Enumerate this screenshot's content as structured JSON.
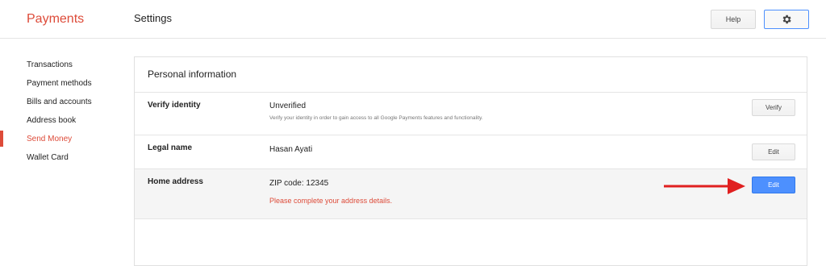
{
  "header": {
    "brand": "Payments",
    "page_title": "Settings",
    "help_label": "Help",
    "settings_icon": "gear-icon"
  },
  "sidebar": {
    "items": [
      {
        "label": "Transactions"
      },
      {
        "label": "Payment methods"
      },
      {
        "label": "Bills and accounts"
      },
      {
        "label": "Address book"
      },
      {
        "label": "Send Money",
        "active": true
      },
      {
        "label": "Wallet Card"
      }
    ]
  },
  "panel": {
    "title": "Personal information",
    "rows": {
      "verify": {
        "label": "Verify identity",
        "value": "Unverified",
        "description": "Verify your identity in order to gain access to all Google Payments features and functionality.",
        "button": "Verify"
      },
      "legal": {
        "label": "Legal name",
        "value": "Hasan Ayati",
        "button": "Edit"
      },
      "home": {
        "label": "Home address",
        "value": "ZIP code: 12345",
        "warning": "Please complete your address details.",
        "button": "Edit"
      }
    }
  },
  "colors": {
    "accent_red": "#dd4b39",
    "primary_blue": "#4d90fe",
    "annotation_arrow": "#e02020"
  }
}
